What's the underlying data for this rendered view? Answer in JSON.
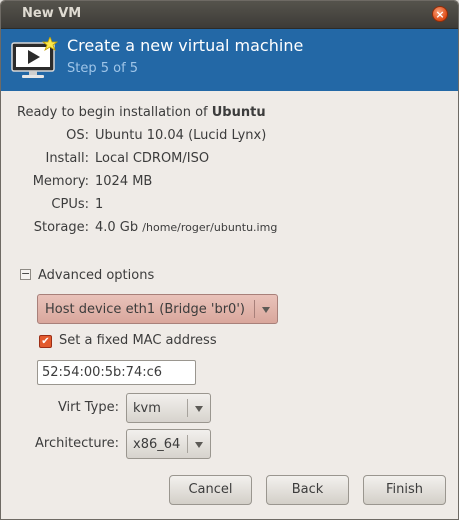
{
  "window": {
    "title": "New VM",
    "close_glyph": "×"
  },
  "banner": {
    "title": "Create a new virtual machine",
    "step": "Step 5 of 5",
    "icon": "monitor-play-icon"
  },
  "summary": {
    "intro": "Ready to begin installation of ",
    "os_name": "Ubuntu",
    "rows": [
      {
        "label": "OS:",
        "value": "Ubuntu 10.04 (Lucid Lynx)"
      },
      {
        "label": "Install:",
        "value": "Local CDROM/ISO"
      },
      {
        "label": "Memory:",
        "value": "1024 MB"
      },
      {
        "label": "CPUs:",
        "value": "1"
      },
      {
        "label": "Storage:",
        "value": "4.0 Gb",
        "extra": "/home/roger/ubuntu.img"
      }
    ]
  },
  "advanced": {
    "expander_glyph": "−",
    "label": "Advanced options",
    "network": "Host device eth1 (Bridge 'br0')",
    "mac_checkbox_label": "Set a fixed MAC address",
    "mac_checked": true,
    "check_glyph": "✔",
    "mac_value": "52:54:00:5b:74:c6",
    "virt_type_label": "Virt Type:",
    "virt_type": "kvm",
    "arch_label": "Architecture:",
    "arch": "x86_64"
  },
  "buttons": {
    "cancel": "Cancel",
    "back": "Back",
    "finish": "Finish"
  },
  "colors": {
    "banner": "#2368a6",
    "accent": "#e35a2d",
    "network_combo": "#e0b3aa"
  }
}
